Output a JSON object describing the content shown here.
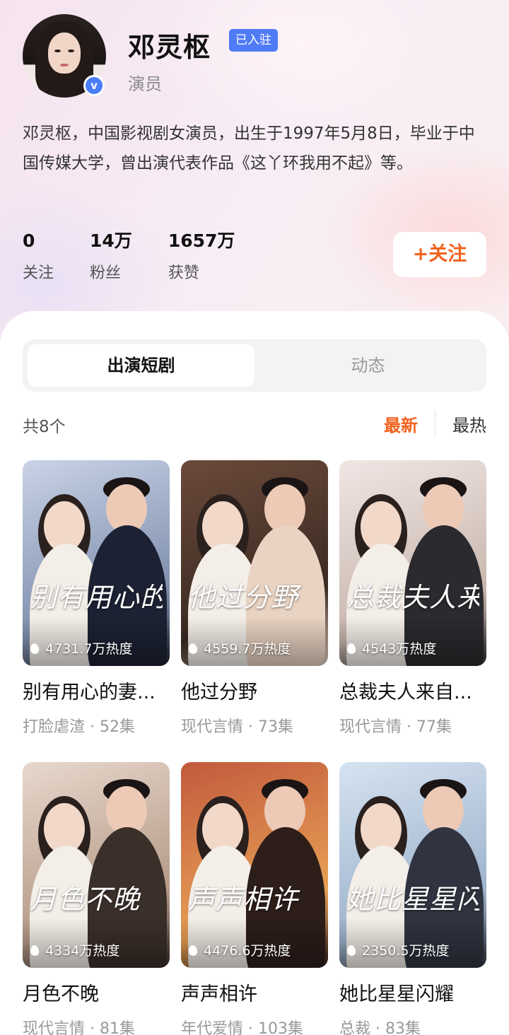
{
  "profile": {
    "name": "邓灵枢",
    "badge": "已入驻",
    "profession": "演员",
    "bio": "邓灵枢，中国影视剧女演员，出生于1997年5月8日，毕业于中国传媒大学，曾出演代表作品《这丫环我用不起》等。",
    "verified_icon": "v-verified-icon",
    "verified_text": "v"
  },
  "stats": [
    {
      "value": "0",
      "label": "关注"
    },
    {
      "value": "14万",
      "label": "粉丝"
    },
    {
      "value": "1657万",
      "label": "获赞"
    }
  ],
  "follow_button": "+关注",
  "tabs": [
    "出演短剧",
    "动态"
  ],
  "active_tab": 0,
  "list": {
    "count_text": "共8个",
    "sort": [
      "最新",
      "最热"
    ],
    "active_sort": 0
  },
  "colors": {
    "accent": "#f2621e",
    "badge_blue": "#4f7bf6"
  },
  "dramas": [
    {
      "title": "别有用心的妻...",
      "poster_text": "别有用心的妻子",
      "heat": "4731.7万热度",
      "genre": "打脸虐渣",
      "episodes": "52集",
      "palette": [
        "#c9d3e6",
        "#7f8fae",
        "#1c2233"
      ]
    },
    {
      "title": "他过分野",
      "poster_text": "他过分野",
      "heat": "4559.7万热度",
      "genre": "现代言情",
      "episodes": "73集",
      "palette": [
        "#6b4a3a",
        "#3a2a22",
        "#e9d3c2"
      ]
    },
    {
      "title": "总裁夫人来自...",
      "poster_text": "总裁夫人来自农村",
      "heat": "4543万热度",
      "genre": "现代言情",
      "episodes": "77集",
      "palette": [
        "#f0e6e4",
        "#c9b7ae",
        "#2b2a2e"
      ]
    },
    {
      "title": "月色不晚",
      "poster_text": "月色不晚",
      "heat": "4334万热度",
      "genre": "现代言情",
      "episodes": "81集",
      "palette": [
        "#e8d8cd",
        "#b59a87",
        "#3b2f2a"
      ]
    },
    {
      "title": "声声相许",
      "poster_text": "声声相许",
      "heat": "4476.6万热度",
      "genre": "年代爱情",
      "episodes": "103集",
      "palette": [
        "#c25a3d",
        "#e7a055",
        "#2d1e1a"
      ]
    },
    {
      "title": "她比星星闪耀",
      "poster_text": "她比星星闪耀",
      "heat": "2350.5万热度",
      "genre": "总裁",
      "episodes": "83集",
      "palette": [
        "#d6e3f1",
        "#9db3cc",
        "#2f3440"
      ]
    }
  ]
}
